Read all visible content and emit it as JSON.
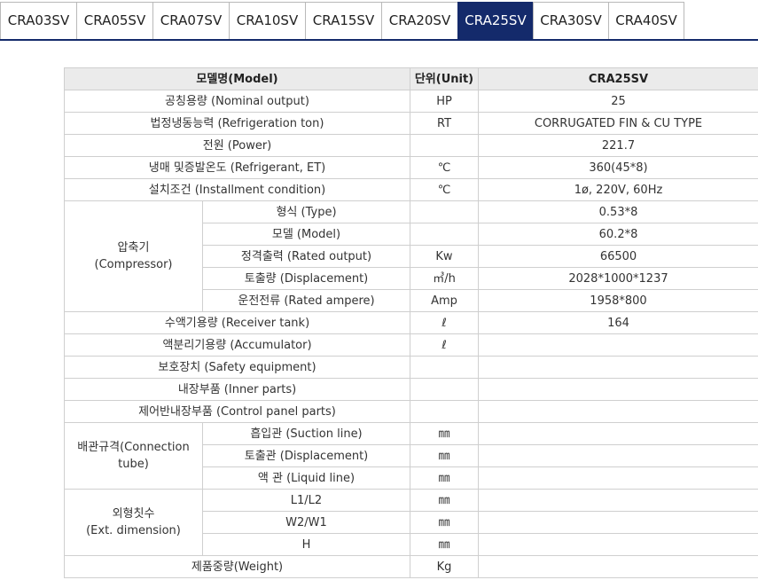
{
  "tabs": [
    {
      "label": "CRA03SV",
      "active": false
    },
    {
      "label": "CRA05SV",
      "active": false
    },
    {
      "label": "CRA07SV",
      "active": false
    },
    {
      "label": "CRA10SV",
      "active": false
    },
    {
      "label": "CRA15SV",
      "active": false
    },
    {
      "label": "CRA20SV",
      "active": false
    },
    {
      "label": "CRA25SV",
      "active": true
    },
    {
      "label": "CRA30SV",
      "active": false
    },
    {
      "label": "CRA40SV",
      "active": false
    }
  ],
  "table": {
    "headers": {
      "model": "모델명(Model)",
      "unit": "단위(Unit)",
      "value": "CRA25SV"
    },
    "rows": {
      "nominal_output": {
        "label": "공칭용량 (Nominal output)",
        "unit": "HP",
        "value": "25"
      },
      "refrigeration_ton": {
        "label": "법정냉동능력 (Refrigeration ton)",
        "unit": "RT",
        "value": "CORRUGATED FIN & CU TYPE"
      },
      "power": {
        "label": "전원 (Power)",
        "unit": "",
        "value": "221.7"
      },
      "refrigerant": {
        "label": "냉매 및증발온도 (Refrigerant, ET)",
        "unit": "℃",
        "value": "360(45*8)"
      },
      "installment": {
        "label": "설치조건 (Installment condition)",
        "unit": "℃",
        "value": "1ø, 220V, 60Hz"
      },
      "receiver_tank": {
        "label": "수액기용량 (Receiver tank)",
        "unit": "ℓ",
        "value": "164"
      },
      "accumulator": {
        "label": "액분리기용량 (Accumulator)",
        "unit": "ℓ",
        "value": ""
      },
      "safety": {
        "label": "보호장치 (Safety equipment)",
        "unit": "",
        "value": ""
      },
      "inner_parts": {
        "label": "내장부품 (Inner parts)",
        "unit": "",
        "value": ""
      },
      "control_panel": {
        "label": "제어반내장부품 (Control panel parts)",
        "unit": "",
        "value": ""
      },
      "weight": {
        "label": "제품중량(Weight)",
        "unit": "Kg",
        "value": ""
      }
    },
    "compressor": {
      "group_label_ko": "압축기",
      "group_label_en": "(Compressor)",
      "rows": [
        {
          "label": "형식 (Type)",
          "unit": "",
          "value": "0.53*8"
        },
        {
          "label": "모델 (Model)",
          "unit": "",
          "value": "60.2*8"
        },
        {
          "label": "정격출력 (Rated output)",
          "unit": "Kw",
          "value": "66500"
        },
        {
          "label": "토출량 (Displacement)",
          "unit": "㎥/h",
          "value": "2028*1000*1237"
        },
        {
          "label": "운전전류 (Rated ampere)",
          "unit": "Amp",
          "value": "1958*800"
        }
      ]
    },
    "connection": {
      "group_label_1": "배관규격(Connection",
      "group_label_2": "tube)",
      "rows": [
        {
          "label": "흡입관 (Suction line)",
          "unit": "㎜",
          "value": ""
        },
        {
          "label": "토출관 (Displacement)",
          "unit": "㎜",
          "value": ""
        },
        {
          "label": "액 관 (Liquid line)",
          "unit": "㎜",
          "value": ""
        }
      ]
    },
    "dimension": {
      "group_label_ko": "외형칫수",
      "group_label_en": "(Ext. dimension)",
      "rows": [
        {
          "label": "L1/L2",
          "unit": "㎜",
          "value": ""
        },
        {
          "label": "W2/W1",
          "unit": "㎜",
          "value": ""
        },
        {
          "label": "H",
          "unit": "㎜",
          "value": ""
        }
      ]
    }
  }
}
